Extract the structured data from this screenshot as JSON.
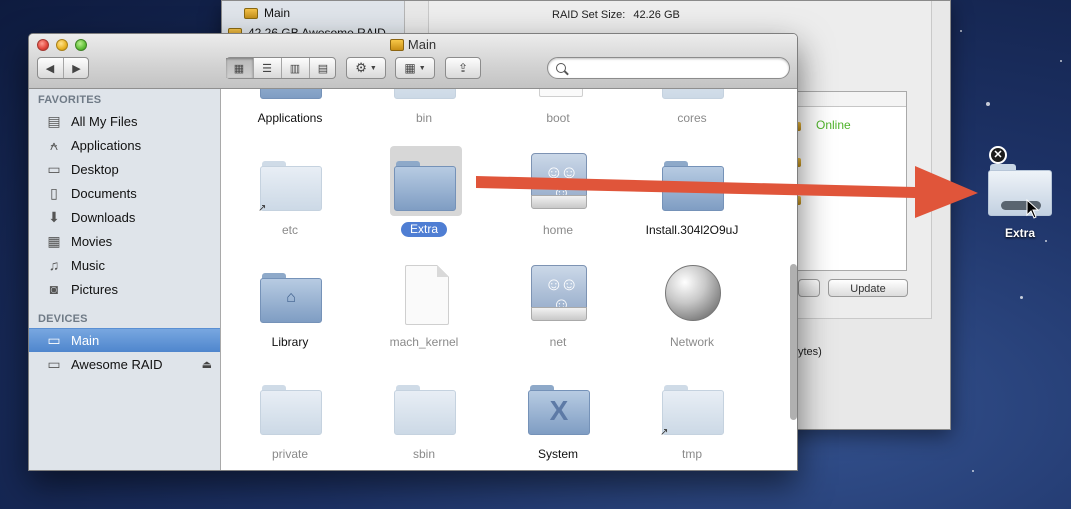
{
  "desktop": {
    "drag_item": {
      "label": "Extra",
      "badge_icon": "remove-badge-icon"
    }
  },
  "bg_window": {
    "sidebar": [
      {
        "label": "Main"
      },
      {
        "label": "42.26 GB Awesome RAID"
      }
    ],
    "raid_set_size_label": "RAID Set Size:",
    "raid_set_size_value": "42.26 GB",
    "status": "Online",
    "update_button": "Update",
    "bytes_fragment": "ytes)"
  },
  "finder": {
    "title": "Main",
    "nav": {
      "back_icon": "back-arrow-icon",
      "forward_icon": "forward-arrow-icon"
    },
    "view_modes": [
      "icon-view",
      "list-view",
      "column-view",
      "coverflow-view"
    ],
    "search_placeholder": "",
    "sidebar": {
      "favorites_header": "FAVORITES",
      "favorites": [
        {
          "label": "All My Files",
          "icon": "all-files-icon"
        },
        {
          "label": "Applications",
          "icon": "applications-icon"
        },
        {
          "label": "Desktop",
          "icon": "desktop-icon"
        },
        {
          "label": "Documents",
          "icon": "documents-icon"
        },
        {
          "label": "Downloads",
          "icon": "downloads-icon"
        },
        {
          "label": "Movies",
          "icon": "movies-icon"
        },
        {
          "label": "Music",
          "icon": "music-icon"
        },
        {
          "label": "Pictures",
          "icon": "pictures-icon"
        }
      ],
      "devices_header": "DEVICES",
      "devices": [
        {
          "label": "Main",
          "selected": true
        },
        {
          "label": "Awesome RAID",
          "ejectable": true
        }
      ]
    },
    "items": [
      {
        "label": "Applications"
      },
      {
        "label": "bin"
      },
      {
        "label": "boot"
      },
      {
        "label": "cores"
      },
      {
        "label": "etc"
      },
      {
        "label": "Extra",
        "selected": true
      },
      {
        "label": "home"
      },
      {
        "label": "Install.304l2O9uJ"
      },
      {
        "label": "Library"
      },
      {
        "label": "mach_kernel"
      },
      {
        "label": "net"
      },
      {
        "label": "Network"
      },
      {
        "label": "private"
      },
      {
        "label": "sbin"
      },
      {
        "label": "System"
      },
      {
        "label": "tmp"
      }
    ]
  },
  "colors": {
    "drag_arrow": "#e0553a",
    "selection": "#4f7ed3",
    "online": "#4fb32a"
  }
}
